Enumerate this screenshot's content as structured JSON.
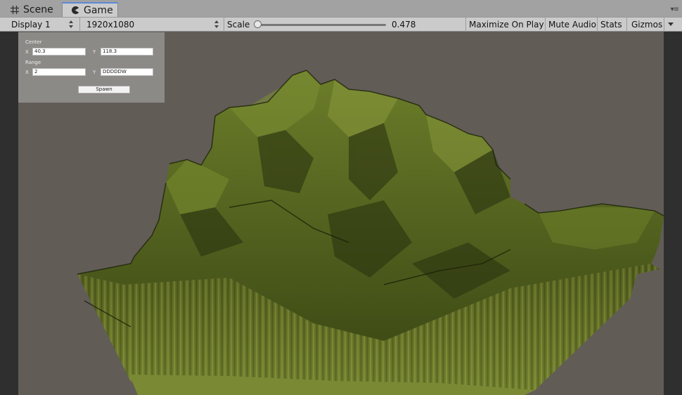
{
  "tabs": [
    {
      "label": "Scene",
      "icon": "grid-icon",
      "active": false
    },
    {
      "label": "Game",
      "icon": "pacman-icon",
      "active": true
    }
  ],
  "toolbar": {
    "display": "Display 1",
    "resolution": "1920x1080",
    "scale_label": "Scale",
    "scale_value": "0.478",
    "maximize": "Maximize On Play",
    "mute": "Mute Audio",
    "stats": "Stats",
    "gizmos": "Gizmos"
  },
  "panel": {
    "center_label": "Center",
    "center_x_label": "X",
    "center_x": "40.3",
    "center_y_label": "Y",
    "center_y": "118.3",
    "range_label": "Range",
    "range_x_label": "X",
    "range_x": "2",
    "range_y_label": "Y",
    "range_y": "DDDDDW",
    "spawn": "Spawn"
  },
  "colors": {
    "game_background": "#625c57",
    "terrain_green": "#5a6a1e",
    "tab_accent": "#5b8ad6"
  }
}
